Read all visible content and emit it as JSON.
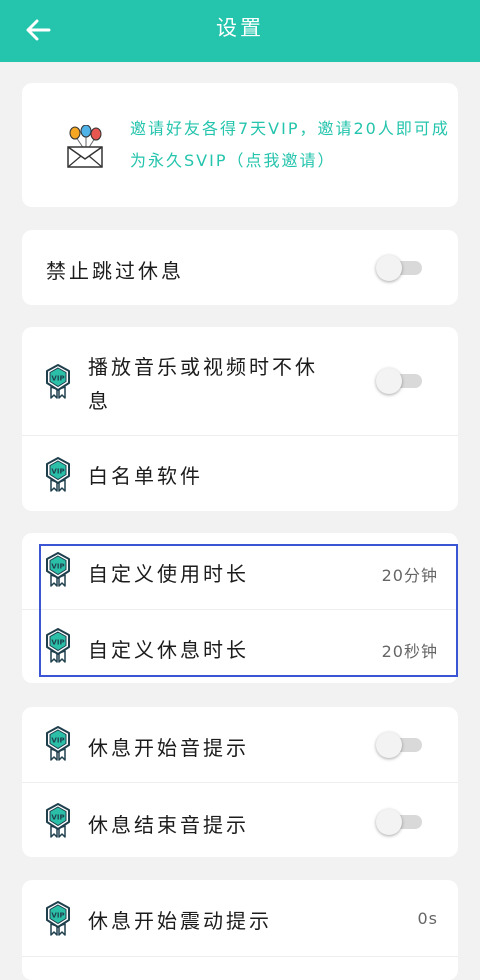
{
  "appbar": {
    "title": "设置",
    "back_icon": "arrow-left-icon",
    "background": "#25c4ad"
  },
  "invite": {
    "icon": "envelope-balloons-icon",
    "text": "邀请好友各得7天VIP，邀请20人即可成为永久SVIP（点我邀请）",
    "color": "#25c4ad"
  },
  "settings": {
    "forbid_skip": {
      "label": "禁止跳过休息",
      "enabled": false
    },
    "media_no_rest": {
      "label": "播放音乐或视频时不休息",
      "vip": true,
      "enabled": false
    },
    "whitelist": {
      "label": "白名单软件",
      "vip": true
    },
    "custom_use_duration": {
      "label": "自定义使用时长",
      "vip": true,
      "value": "20分钟"
    },
    "custom_rest_duration": {
      "label": "自定义休息时长",
      "vip": true,
      "value": "20秒钟"
    },
    "rest_start_sound": {
      "label": "休息开始音提示",
      "vip": true,
      "enabled": false
    },
    "rest_end_sound": {
      "label": "休息结束音提示",
      "vip": true,
      "enabled": false
    },
    "rest_start_vibration": {
      "label": "休息开始震动提示",
      "vip": true,
      "value": "0s"
    }
  },
  "vip_badge_text": "VIP",
  "highlight_color": "#3b55d4"
}
